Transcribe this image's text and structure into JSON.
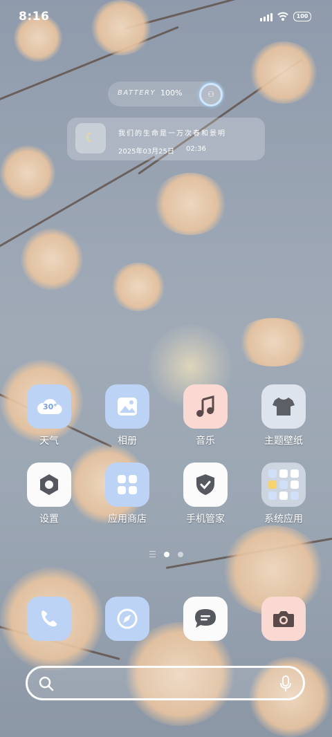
{
  "status_bar": {
    "time": "8:16",
    "battery": "100"
  },
  "widget": {
    "battery_label": "BATTERY",
    "battery_value": "100%",
    "quote": "我们的生命是一万次春和景明",
    "date": "2025年03月25日",
    "clock": "02:36"
  },
  "apps": [
    {
      "label": "天气",
      "icon": "weather-icon",
      "temp": "30°"
    },
    {
      "label": "相册",
      "icon": "gallery-icon"
    },
    {
      "label": "音乐",
      "icon": "music-icon"
    },
    {
      "label": "主题壁纸",
      "icon": "themes-icon"
    },
    {
      "label": "设置",
      "icon": "settings-icon"
    },
    {
      "label": "应用商店",
      "icon": "app-store-icon"
    },
    {
      "label": "手机管家",
      "icon": "security-icon"
    },
    {
      "label": "系统应用",
      "icon": "folder-icon"
    }
  ],
  "dock": [
    {
      "icon": "phone-icon"
    },
    {
      "icon": "browser-icon"
    },
    {
      "icon": "messages-icon"
    },
    {
      "icon": "camera-icon"
    }
  ],
  "page_indicator": {
    "pages": 2,
    "active": 0
  },
  "colors": {
    "icon_blue": "#bcd3f5",
    "icon_pink": "#fbd9d3",
    "icon_grey": "#dde4ee",
    "glyph": "#ffffff"
  }
}
